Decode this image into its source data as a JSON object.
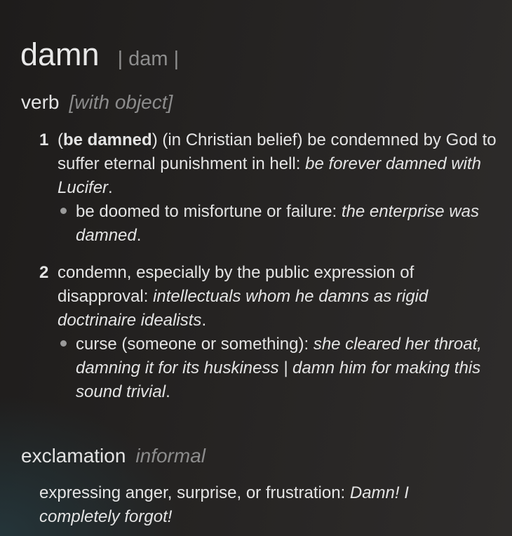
{
  "headword": "damn",
  "pronunciation": "| dam |",
  "senses_block": {
    "pos": "verb",
    "grammar": "[with object]",
    "senses": [
      {
        "num": "1",
        "pre": "(",
        "bold": "be damned",
        "post": ") (in Christian belief) be condemned by God to suffer eternal punishment in hell: ",
        "example": "be forever damned with Lucifer",
        "end": ".",
        "sub": {
          "text": "be doomed to misfortune or failure: ",
          "example": "the enterprise was damned",
          "end": "."
        }
      },
      {
        "num": "2",
        "pre": "",
        "bold": "",
        "post": "condemn, especially by the public expression of disapproval: ",
        "example": "intellectuals whom he damns as rigid doctrinaire idealists",
        "end": ".",
        "sub": {
          "text": "curse (someone or something): ",
          "example": "she cleared her throat, damning it for its huskiness | damn him for making this sound trivial",
          "end": "."
        }
      }
    ]
  },
  "exclamation": {
    "pos": "exclamation",
    "register": "informal",
    "text": "expressing anger, surprise, or frustration: ",
    "example": "Damn! I completely forgot!"
  }
}
